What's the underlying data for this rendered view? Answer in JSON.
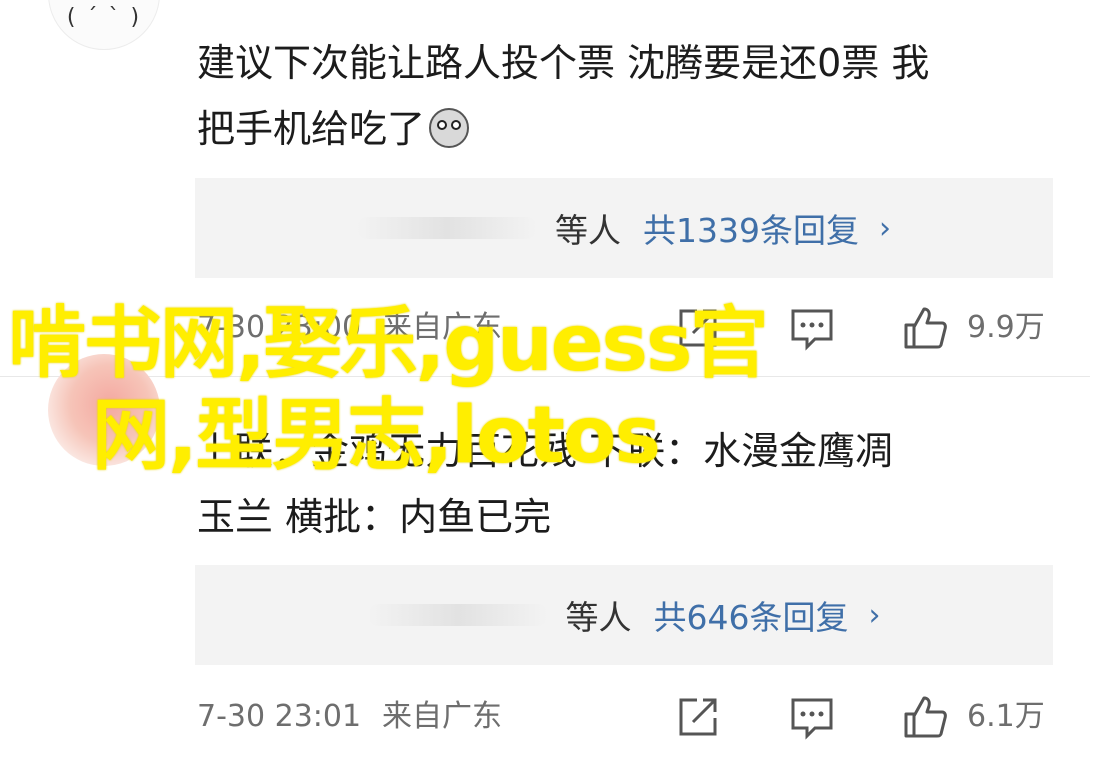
{
  "comments": [
    {
      "text_lines": [
        "建议下次能让路人投个票 沈腾要是还0票 我",
        "把手机给吃了"
      ],
      "replies": {
        "who": "等人",
        "count_label": "共1339条回复",
        "chevron": "›"
      },
      "meta": {
        "time": "7-30 23:00",
        "source": "来自广东",
        "likes": "9.9万"
      }
    },
    {
      "text_lines": [
        "上联：金鸡无力百花残 下联：水漫金鹰凋",
        "玉兰 横批：内鱼已完"
      ],
      "replies": {
        "who": "等人",
        "count_label": "共646条回复",
        "chevron": "›"
      },
      "meta": {
        "time": "7-30 23:01",
        "source": "来自广东",
        "likes": "6.1万"
      }
    }
  ],
  "overlay": {
    "line1": "啃书网,娶乐,guess官",
    "line2": "网,型男志,lotos"
  },
  "colors": {
    "link": "#3f6fa8",
    "overlay": "#ffee00",
    "reply_bg": "#f3f3f3"
  },
  "icons": [
    "share-icon",
    "comment-icon",
    "like-icon",
    "chevron-right-icon",
    "dog-emoji-icon"
  ]
}
